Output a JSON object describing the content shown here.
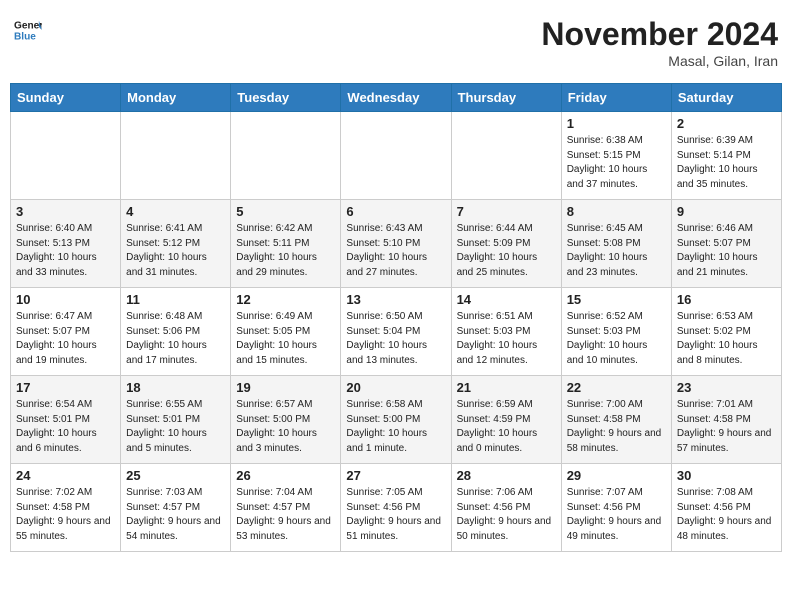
{
  "header": {
    "logo_line1": "General",
    "logo_line2": "Blue",
    "month_title": "November 2024",
    "location": "Masal, Gilan, Iran"
  },
  "weekdays": [
    "Sunday",
    "Monday",
    "Tuesday",
    "Wednesday",
    "Thursday",
    "Friday",
    "Saturday"
  ],
  "weeks": [
    [
      {
        "day": "",
        "info": ""
      },
      {
        "day": "",
        "info": ""
      },
      {
        "day": "",
        "info": ""
      },
      {
        "day": "",
        "info": ""
      },
      {
        "day": "",
        "info": ""
      },
      {
        "day": "1",
        "info": "Sunrise: 6:38 AM\nSunset: 5:15 PM\nDaylight: 10 hours and 37 minutes."
      },
      {
        "day": "2",
        "info": "Sunrise: 6:39 AM\nSunset: 5:14 PM\nDaylight: 10 hours and 35 minutes."
      }
    ],
    [
      {
        "day": "3",
        "info": "Sunrise: 6:40 AM\nSunset: 5:13 PM\nDaylight: 10 hours and 33 minutes."
      },
      {
        "day": "4",
        "info": "Sunrise: 6:41 AM\nSunset: 5:12 PM\nDaylight: 10 hours and 31 minutes."
      },
      {
        "day": "5",
        "info": "Sunrise: 6:42 AM\nSunset: 5:11 PM\nDaylight: 10 hours and 29 minutes."
      },
      {
        "day": "6",
        "info": "Sunrise: 6:43 AM\nSunset: 5:10 PM\nDaylight: 10 hours and 27 minutes."
      },
      {
        "day": "7",
        "info": "Sunrise: 6:44 AM\nSunset: 5:09 PM\nDaylight: 10 hours and 25 minutes."
      },
      {
        "day": "8",
        "info": "Sunrise: 6:45 AM\nSunset: 5:08 PM\nDaylight: 10 hours and 23 minutes."
      },
      {
        "day": "9",
        "info": "Sunrise: 6:46 AM\nSunset: 5:07 PM\nDaylight: 10 hours and 21 minutes."
      }
    ],
    [
      {
        "day": "10",
        "info": "Sunrise: 6:47 AM\nSunset: 5:07 PM\nDaylight: 10 hours and 19 minutes."
      },
      {
        "day": "11",
        "info": "Sunrise: 6:48 AM\nSunset: 5:06 PM\nDaylight: 10 hours and 17 minutes."
      },
      {
        "day": "12",
        "info": "Sunrise: 6:49 AM\nSunset: 5:05 PM\nDaylight: 10 hours and 15 minutes."
      },
      {
        "day": "13",
        "info": "Sunrise: 6:50 AM\nSunset: 5:04 PM\nDaylight: 10 hours and 13 minutes."
      },
      {
        "day": "14",
        "info": "Sunrise: 6:51 AM\nSunset: 5:03 PM\nDaylight: 10 hours and 12 minutes."
      },
      {
        "day": "15",
        "info": "Sunrise: 6:52 AM\nSunset: 5:03 PM\nDaylight: 10 hours and 10 minutes."
      },
      {
        "day": "16",
        "info": "Sunrise: 6:53 AM\nSunset: 5:02 PM\nDaylight: 10 hours and 8 minutes."
      }
    ],
    [
      {
        "day": "17",
        "info": "Sunrise: 6:54 AM\nSunset: 5:01 PM\nDaylight: 10 hours and 6 minutes."
      },
      {
        "day": "18",
        "info": "Sunrise: 6:55 AM\nSunset: 5:01 PM\nDaylight: 10 hours and 5 minutes."
      },
      {
        "day": "19",
        "info": "Sunrise: 6:57 AM\nSunset: 5:00 PM\nDaylight: 10 hours and 3 minutes."
      },
      {
        "day": "20",
        "info": "Sunrise: 6:58 AM\nSunset: 5:00 PM\nDaylight: 10 hours and 1 minute."
      },
      {
        "day": "21",
        "info": "Sunrise: 6:59 AM\nSunset: 4:59 PM\nDaylight: 10 hours and 0 minutes."
      },
      {
        "day": "22",
        "info": "Sunrise: 7:00 AM\nSunset: 4:58 PM\nDaylight: 9 hours and 58 minutes."
      },
      {
        "day": "23",
        "info": "Sunrise: 7:01 AM\nSunset: 4:58 PM\nDaylight: 9 hours and 57 minutes."
      }
    ],
    [
      {
        "day": "24",
        "info": "Sunrise: 7:02 AM\nSunset: 4:58 PM\nDaylight: 9 hours and 55 minutes."
      },
      {
        "day": "25",
        "info": "Sunrise: 7:03 AM\nSunset: 4:57 PM\nDaylight: 9 hours and 54 minutes."
      },
      {
        "day": "26",
        "info": "Sunrise: 7:04 AM\nSunset: 4:57 PM\nDaylight: 9 hours and 53 minutes."
      },
      {
        "day": "27",
        "info": "Sunrise: 7:05 AM\nSunset: 4:56 PM\nDaylight: 9 hours and 51 minutes."
      },
      {
        "day": "28",
        "info": "Sunrise: 7:06 AM\nSunset: 4:56 PM\nDaylight: 9 hours and 50 minutes."
      },
      {
        "day": "29",
        "info": "Sunrise: 7:07 AM\nSunset: 4:56 PM\nDaylight: 9 hours and 49 minutes."
      },
      {
        "day": "30",
        "info": "Sunrise: 7:08 AM\nSunset: 4:56 PM\nDaylight: 9 hours and 48 minutes."
      }
    ]
  ]
}
